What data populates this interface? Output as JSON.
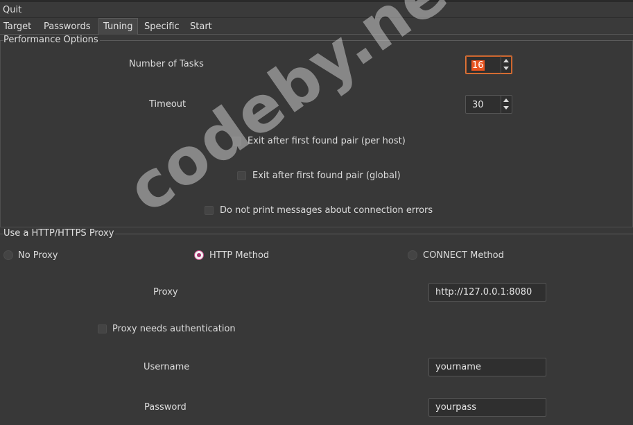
{
  "menubar": {
    "quit": "Quit"
  },
  "tabs": [
    {
      "label": "Target"
    },
    {
      "label": "Passwords"
    },
    {
      "label": "Tuning",
      "active": true
    },
    {
      "label": "Specific"
    },
    {
      "label": "Start"
    }
  ],
  "performance": {
    "title": "Performance Options",
    "tasks_label": "Number of Tasks",
    "tasks_value": "16",
    "timeout_label": "Timeout",
    "timeout_value": "30",
    "exit_per_host": "Exit after first found pair (per host)",
    "exit_global": "Exit after first found pair (global)",
    "no_conn_errors": "Do not print messages about connection errors"
  },
  "proxy": {
    "title": "Use a HTTP/HTTPS Proxy",
    "no_proxy": "No Proxy",
    "http_method": "HTTP Method",
    "connect_method": "CONNECT Method",
    "proxy_label": "Proxy",
    "proxy_value": "http://127.0.0.1:8080",
    "auth_label": "Proxy needs authentication",
    "username_label": "Username",
    "username_value": "yourname",
    "password_label": "Password",
    "password_value": "yourpass"
  },
  "watermark": "codeby.net",
  "colors": {
    "accent": "#e95420",
    "radio_selected": "#a5356e",
    "background": "#383838"
  }
}
